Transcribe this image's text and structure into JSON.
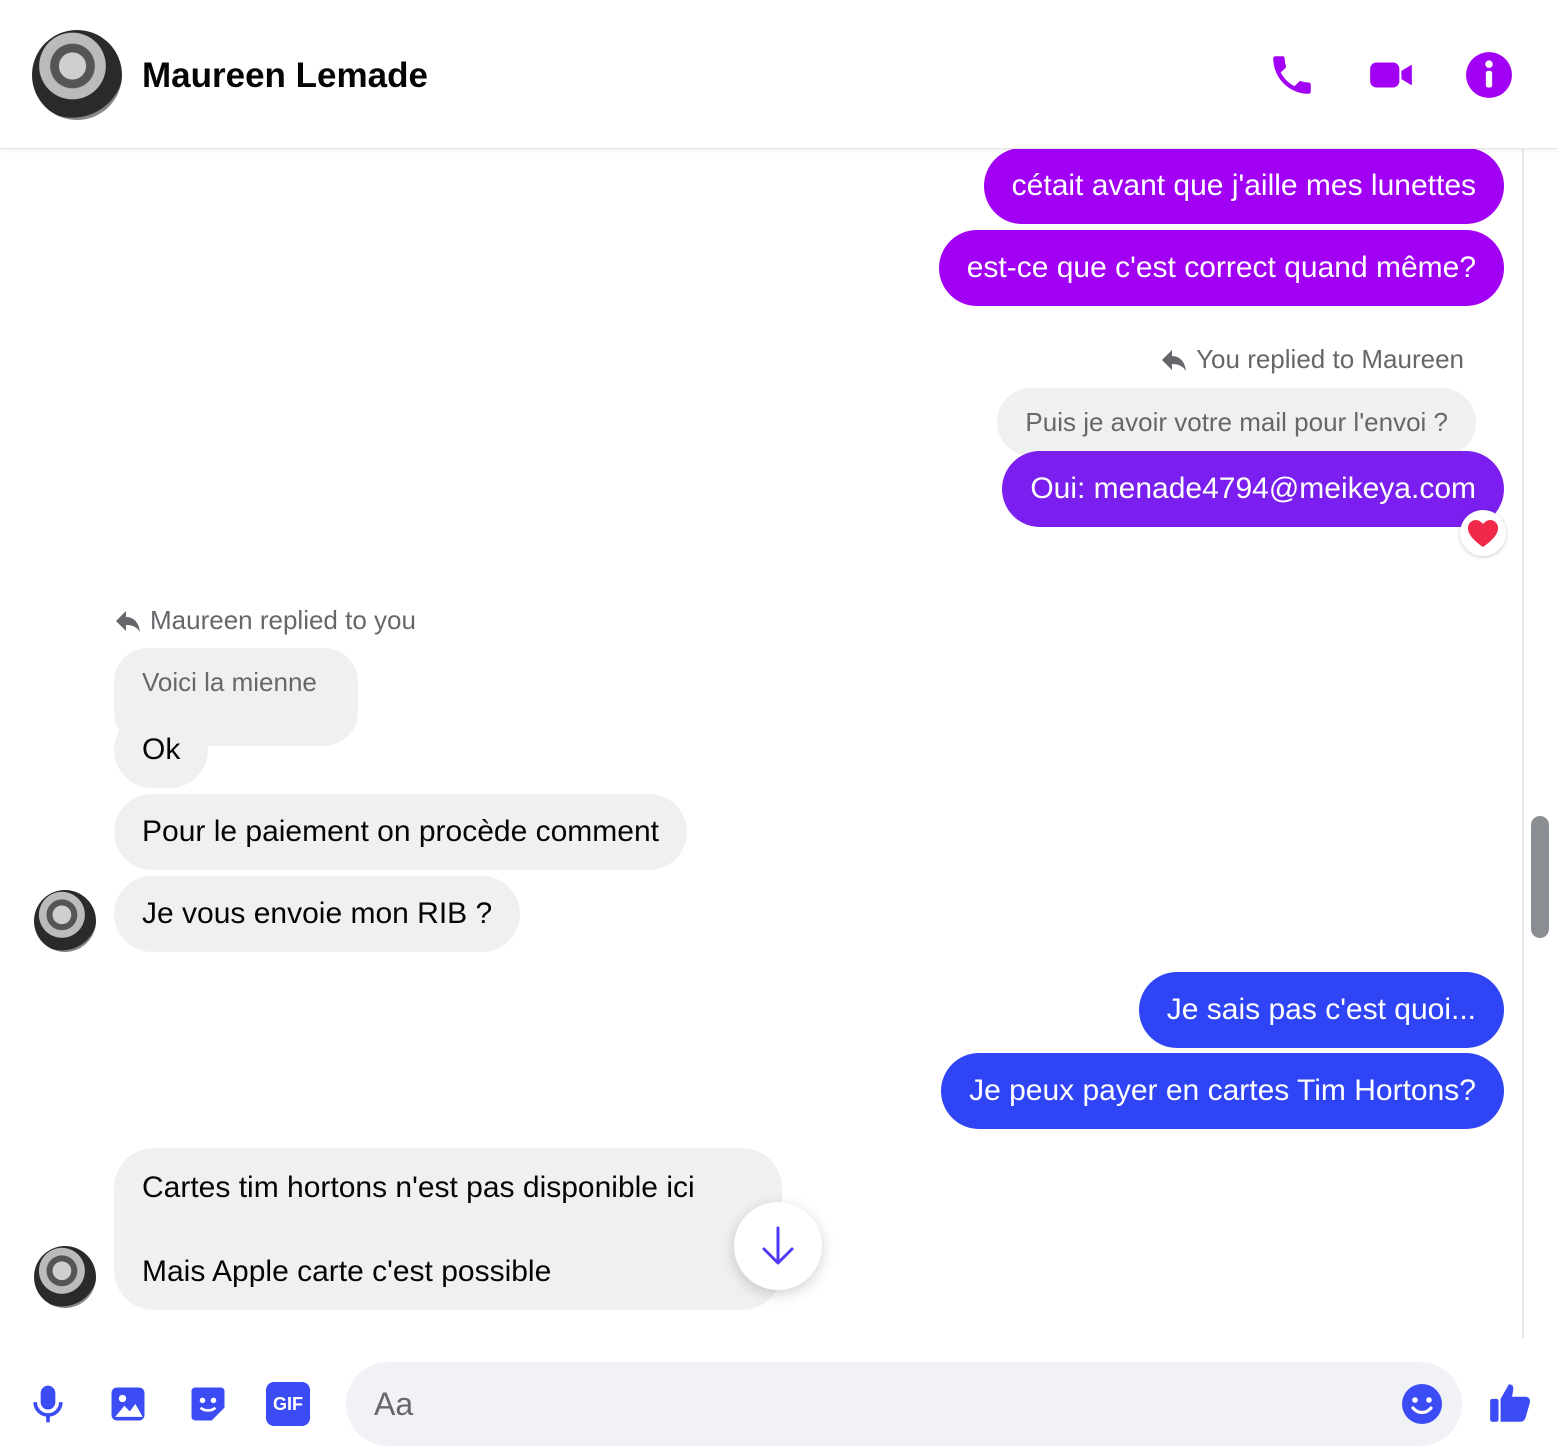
{
  "header": {
    "contact_name": "Maureen Lemade",
    "actions": [
      "phone-icon",
      "video-icon",
      "info-icon"
    ],
    "accent_color": "#a100f5"
  },
  "messages": {
    "out1": "cétait avant que j'aille mes lunettes",
    "out2": "est-ce que c'est correct quand même?",
    "reply1_label": "You replied to Maureen",
    "reply1_quote": "Puis je avoir votre mail pour l'envoi ?",
    "out3": "Oui: menade4794@meikeya.com",
    "out3_reaction": "heart",
    "reply2_label": "Maureen replied to you",
    "reply2_quote": "Voici la mienne",
    "in1": "Ok",
    "in2": "Pour le paiement on procède comment",
    "in3": "Je vous envoie mon RIB ?",
    "out4": "Je sais pas c'est quoi...",
    "out5": "Je peux payer en cartes Tim Hortons?",
    "in4_line1": "Cartes tim hortons n'est pas disponible ici",
    "in4_line2": "Mais Apple carte c'est possible"
  },
  "composer": {
    "placeholder": "Aa",
    "icons": [
      "microphone-icon",
      "photo-icon",
      "sticker-icon",
      "gif-icon",
      "emoji-icon",
      "thumbs-up-icon"
    ],
    "gif_label": "GIF"
  }
}
